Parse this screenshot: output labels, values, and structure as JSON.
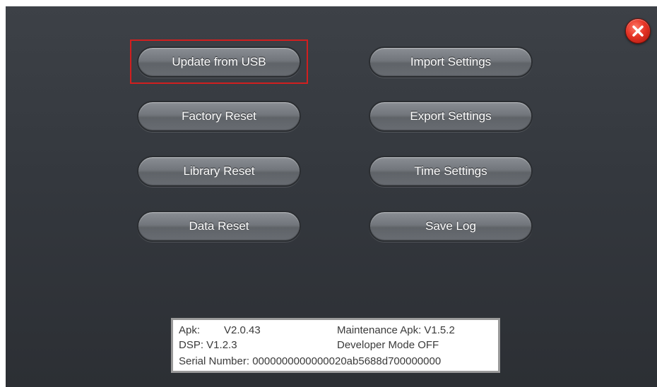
{
  "close_button": {
    "icon": "close-icon",
    "symbol": "X"
  },
  "buttons": {
    "update_usb": "Update from USB",
    "import_settings": "Import Settings",
    "factory_reset": "Factory Reset",
    "export_settings": "Export Settings",
    "library_reset": "Library Reset",
    "time_settings": "Time Settings",
    "data_reset": "Data Reset",
    "save_log": "Save Log"
  },
  "info": {
    "apk_label": "Apk:",
    "apk_value": "V2.0.43",
    "maintenance_apk": "Maintenance Apk: V1.5.2",
    "dsp": "DSP: V1.2.3",
    "developer_mode": "Developer Mode OFF",
    "serial_number": "Serial Number: 0000000000000020ab5688d700000000"
  },
  "colors": {
    "highlight": "#d21f1f",
    "close": "#e53325",
    "background": "#34383e"
  }
}
